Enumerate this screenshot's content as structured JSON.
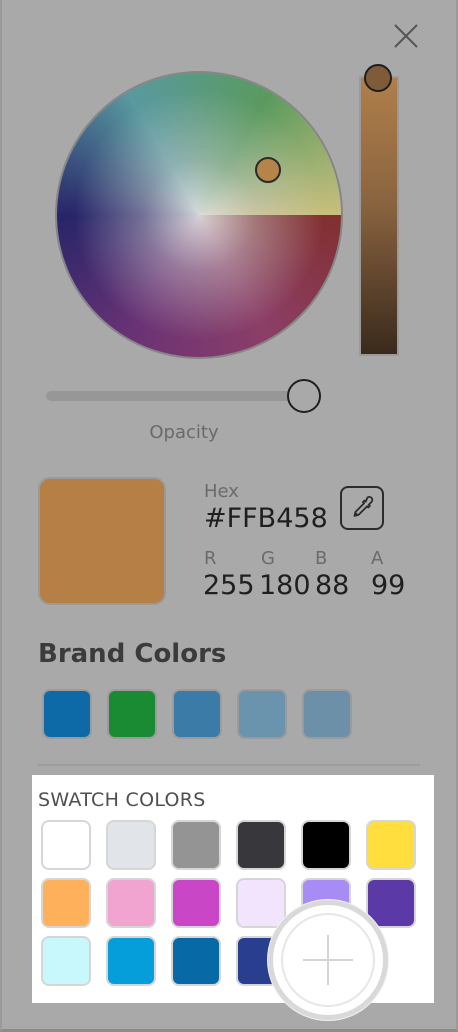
{
  "icons": {
    "close": "close-icon",
    "eyedropper": "eyedropper-icon",
    "add": "plus-icon"
  },
  "opacity": {
    "label": "Opacity",
    "value": 0.99
  },
  "selected_color": {
    "hex_label": "Hex",
    "hex_value": "#FFB458",
    "r_label": "R",
    "r_value": "255",
    "g_label": "G",
    "g_value": "180",
    "b_label": "B",
    "b_value": "88",
    "a_label": "A",
    "a_value": "99",
    "preview_color": "#b57f45"
  },
  "brand": {
    "title": "Brand Colors",
    "colors": [
      "#0d6aa6",
      "#1a8a33",
      "#3b7ba8",
      "#6a93ad",
      "#6b90a8"
    ]
  },
  "swatches": {
    "title": "SWATCH COLORS",
    "colors": [
      "#ffffff",
      "#e1e5e9",
      "#949494",
      "#38373c",
      "#000000",
      "#ffde3d",
      "#ffb05a",
      "#f2a4d0",
      "#c947c6",
      "#f1e4fc",
      "#a88cf6",
      "#5b39a6",
      "#c9f8fc",
      "#069ddb",
      "#0769a6",
      "#293e8e"
    ]
  }
}
